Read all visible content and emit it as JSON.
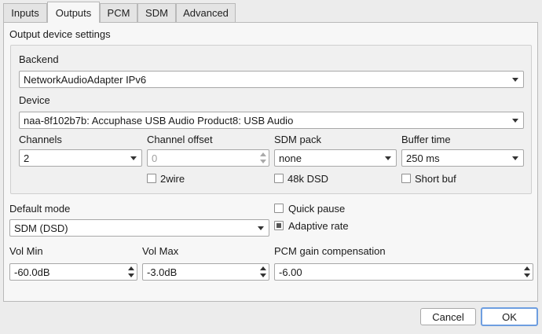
{
  "tabs": [
    {
      "label": "Inputs",
      "active": false
    },
    {
      "label": "Outputs",
      "active": true
    },
    {
      "label": "PCM",
      "active": false
    },
    {
      "label": "SDM",
      "active": false
    },
    {
      "label": "Advanced",
      "active": false
    }
  ],
  "output_settings": {
    "title": "Output device settings",
    "backend": {
      "label": "Backend",
      "value": "NetworkAudioAdapter IPv6"
    },
    "device": {
      "label": "Device",
      "value": "naa-8f102b7b: Accuphase USB Audio Product8: USB Audio"
    },
    "channels": {
      "label": "Channels",
      "value": "2"
    },
    "channel_offset": {
      "label": "Channel offset",
      "value": "0"
    },
    "sdm_pack": {
      "label": "SDM pack",
      "value": "none"
    },
    "buffer_time": {
      "label": "Buffer time",
      "value": "250 ms"
    },
    "twowire": {
      "label": "2wire",
      "checked": false
    },
    "dsd48k": {
      "label": "48k DSD",
      "checked": false
    },
    "short_buf": {
      "label": "Short buf",
      "checked": false
    }
  },
  "default_mode": {
    "label": "Default mode",
    "value": "SDM (DSD)"
  },
  "quick_pause": {
    "label": "Quick pause",
    "checked": false
  },
  "adaptive_rate": {
    "label": "Adaptive rate",
    "state": "partial"
  },
  "vol_min": {
    "label": "Vol Min",
    "value": "-60.0dB"
  },
  "vol_max": {
    "label": "Vol Max",
    "value": "-3.0dB"
  },
  "pcm_gain": {
    "label": "PCM gain compensation",
    "value": "-6.00"
  },
  "buttons": {
    "cancel": "Cancel",
    "ok": "OK"
  },
  "colors": {
    "default_button_border": "#6e9ee0",
    "window_bg": "#ececec",
    "panel_bg": "#f7f7f7"
  }
}
